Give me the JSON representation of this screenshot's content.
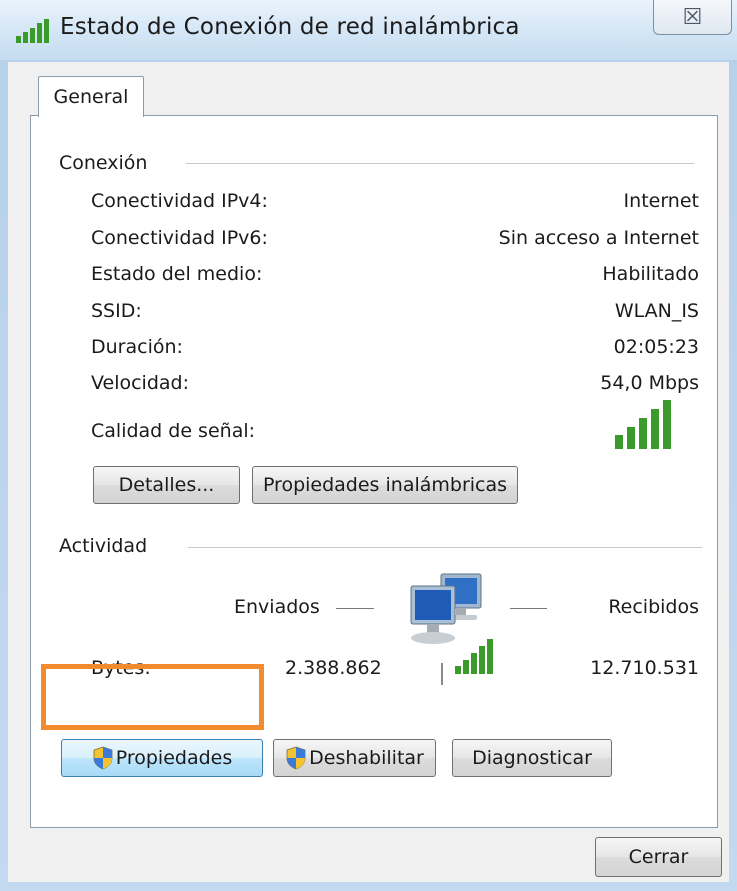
{
  "window": {
    "title": "Estado de Conexión de red inalámbrica",
    "close_glyph": "☒"
  },
  "tabs": [
    {
      "label": "General",
      "selected": true
    }
  ],
  "connection": {
    "group_label": "Conexión",
    "rows": [
      {
        "label": "Conectividad IPv4:",
        "value": "Internet"
      },
      {
        "label": "Conectividad IPv6:",
        "value": "Sin acceso a Internet"
      },
      {
        "label": "Estado del medio:",
        "value": "Habilitado"
      },
      {
        "label": "SSID:",
        "value": "WLAN_IS"
      },
      {
        "label": "Duración:",
        "value": "02:05:23"
      },
      {
        "label": "Velocidad:",
        "value": "54,0 Mbps"
      }
    ],
    "signal_label": "Calidad de señal:",
    "signal_bars_active": 5,
    "signal_bars_total": 5,
    "buttons": {
      "details": "Detalles...",
      "wireless_properties": "Propiedades inalámbricas"
    }
  },
  "activity": {
    "group_label": "Actividad",
    "sent_label": "Enviados",
    "received_label": "Recibidos",
    "bytes_label": "Bytes:",
    "bytes_sent": "2.388.862",
    "bytes_received": "12.710.531"
  },
  "bottom_buttons": {
    "properties": "Propiedades",
    "disable": "Deshabilitar",
    "diagnose": "Diagnosticar"
  },
  "footer": {
    "close": "Cerrar"
  },
  "icons": {
    "title": "wireless-signal-icon",
    "shield": "uac-shield-icon",
    "network": "network-computers-icon"
  },
  "colors": {
    "highlight": "#f28a2e",
    "signal": "#3a9b2a"
  }
}
